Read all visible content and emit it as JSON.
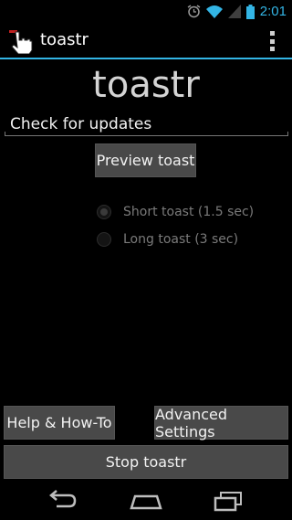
{
  "status_bar": {
    "time": "2:01",
    "icons": [
      "alarm-icon",
      "wifi-icon",
      "signal-icon",
      "battery-icon"
    ],
    "accent_color": "#33b5e5"
  },
  "action_bar": {
    "title": "toastr",
    "app_icon": "pointing-hand-icon",
    "overflow_icon": "overflow-menu-icon"
  },
  "main": {
    "heading": "toastr",
    "check_updates": "Check for updates",
    "preview_button": "Preview toast",
    "duration_options": [
      {
        "label": "Short toast (1.5 sec)",
        "checked": true,
        "enabled": false
      },
      {
        "label": "Long toast (3 sec)",
        "checked": false,
        "enabled": false
      }
    ],
    "help_button": "Help & How-To",
    "advanced_button": "Advanced Settings",
    "stop_button": "Stop toastr"
  },
  "nav_bar": {
    "icons": [
      "back-icon",
      "home-icon",
      "recent-apps-icon"
    ]
  }
}
